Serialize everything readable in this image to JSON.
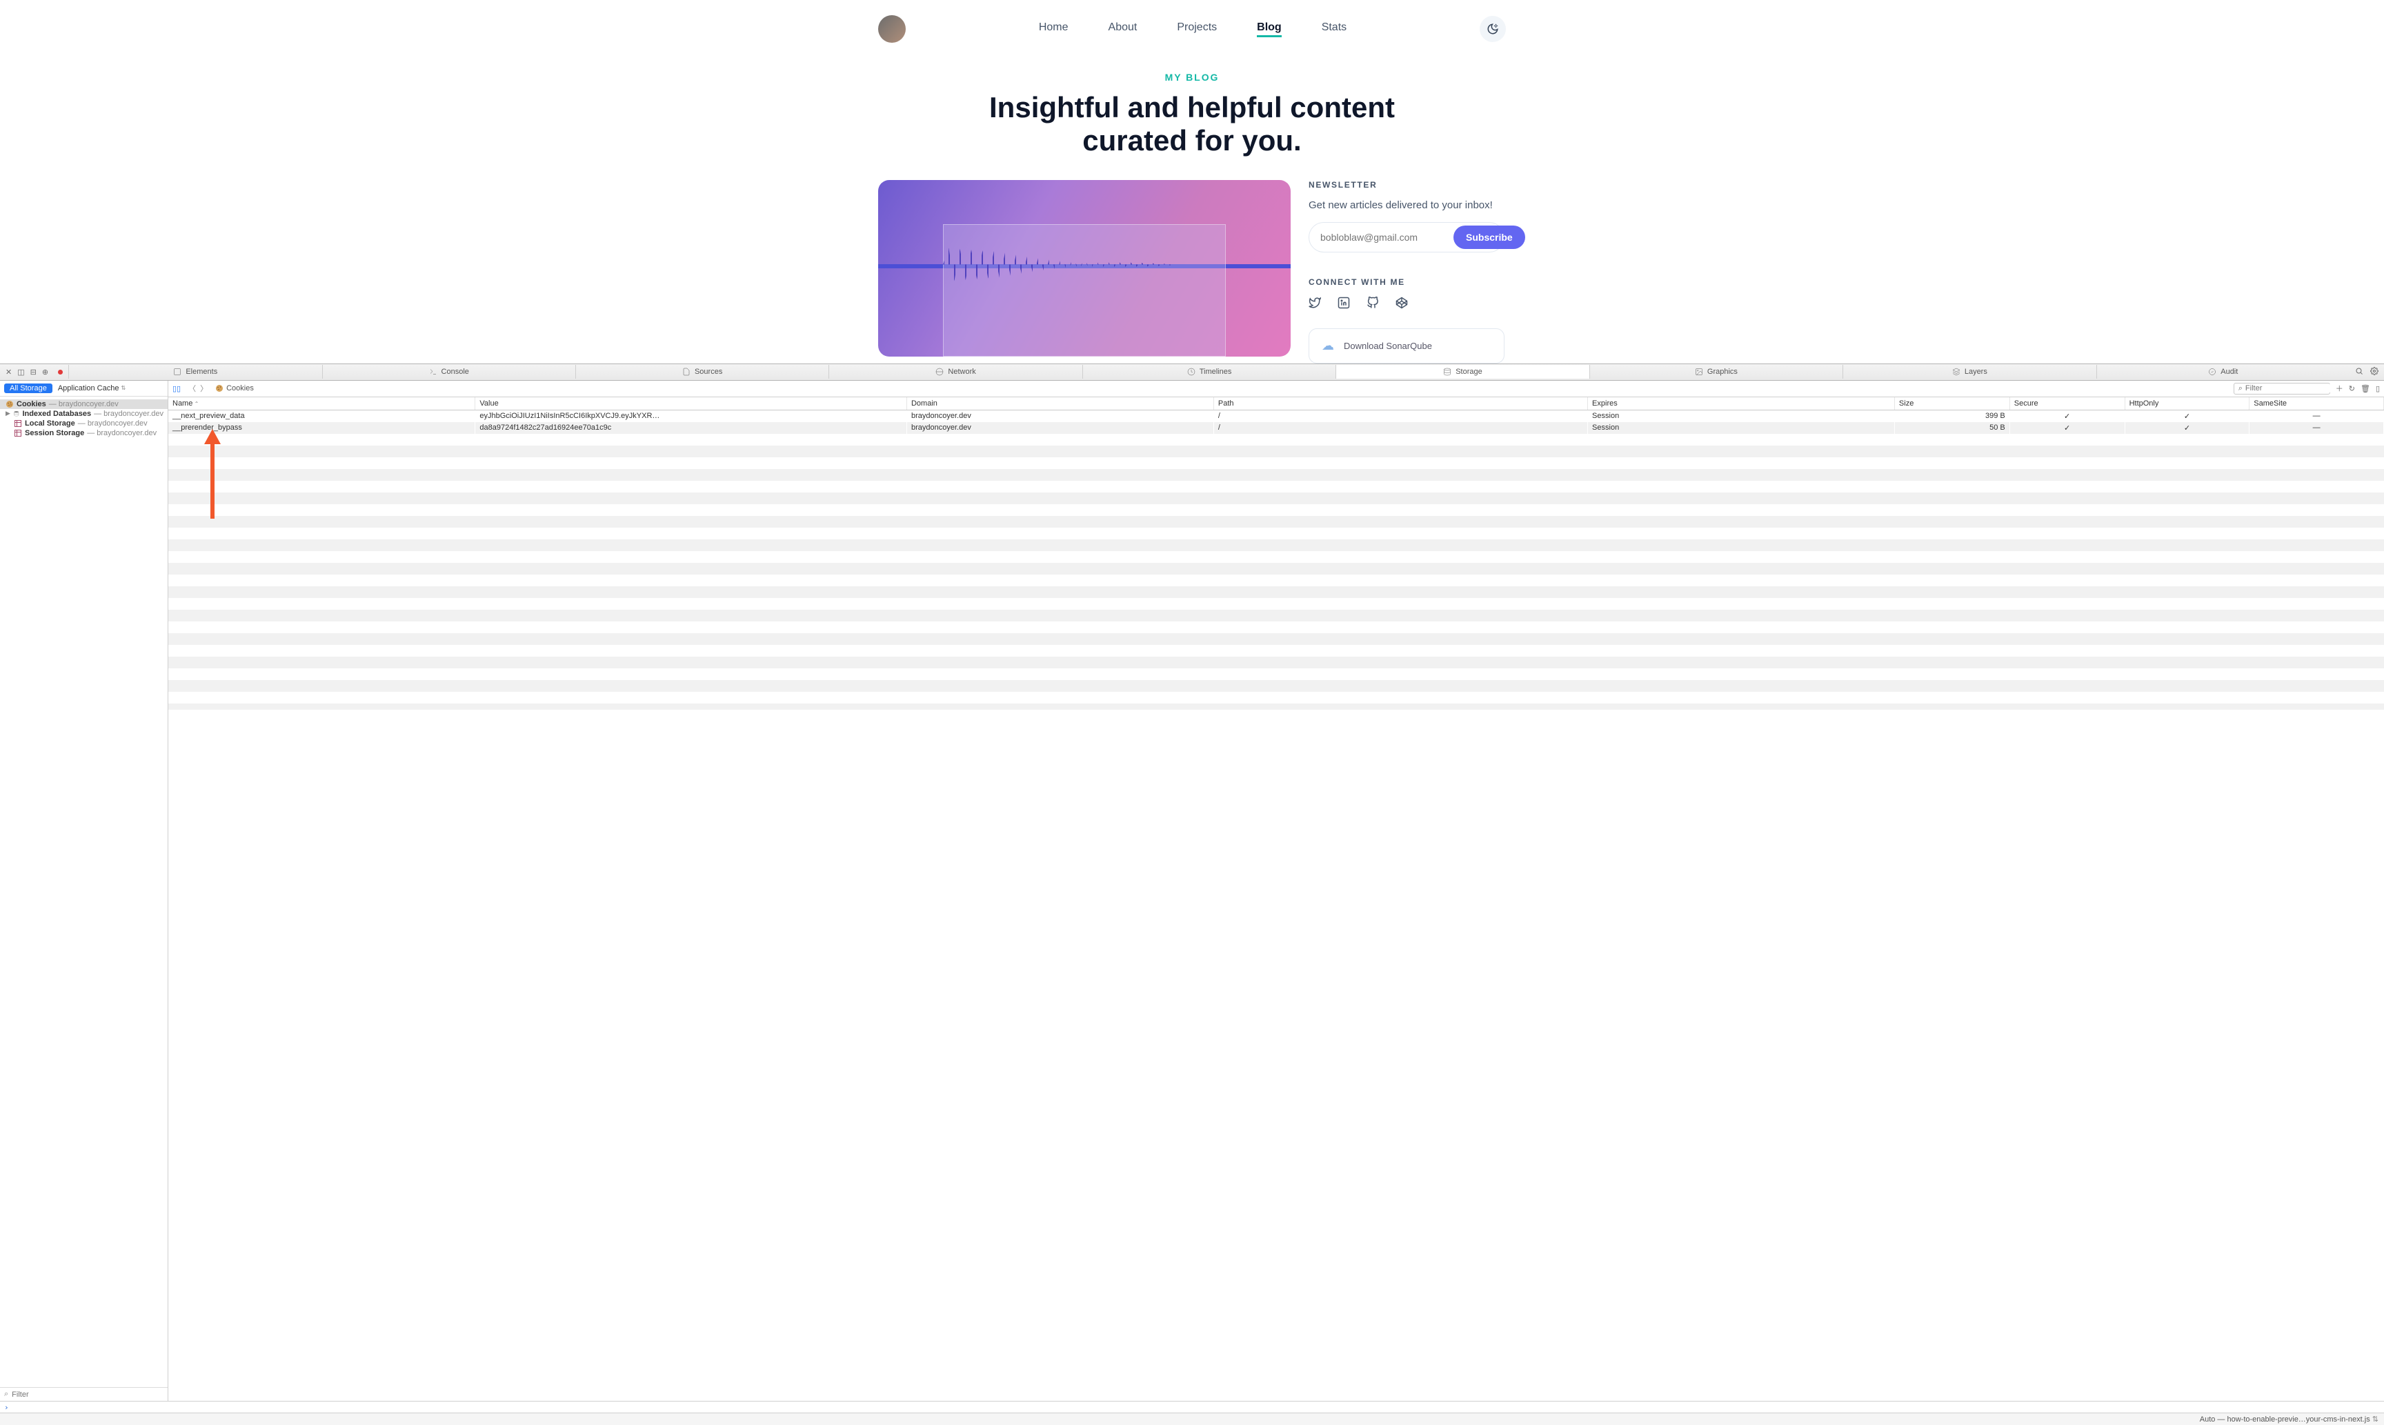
{
  "nav": {
    "links": [
      "Home",
      "About",
      "Projects",
      "Blog",
      "Stats"
    ],
    "active": "Blog"
  },
  "hero": {
    "eyebrow": "MY BLOG",
    "headline_l1": "Insightful and helpful content",
    "headline_l2": "curated for you."
  },
  "newsletter": {
    "title": "NEWSLETTER",
    "blurb": "Get new articles delivered to your inbox!",
    "placeholder": "bobloblaw@gmail.com",
    "button": "Subscribe"
  },
  "connect": {
    "title": "CONNECT WITH ME"
  },
  "ad": {
    "text": "Download SonarQube"
  },
  "devtools": {
    "tabs": [
      "Elements",
      "Console",
      "Sources",
      "Network",
      "Timelines",
      "Storage",
      "Graphics",
      "Layers",
      "Audit"
    ],
    "active_tab": "Storage",
    "subtabs": {
      "active": "All Storage",
      "other": "Application Cache"
    },
    "tree": {
      "cookies": {
        "label": "Cookies",
        "domain": "braydoncoyer.dev"
      },
      "idb": {
        "label": "Indexed Databases",
        "domain": "braydoncoyer.dev"
      },
      "local": {
        "label": "Local Storage",
        "domain": "braydoncoyer.dev"
      },
      "session": {
        "label": "Session Storage",
        "domain": "braydoncoyer.dev"
      }
    },
    "sidebar_filter_placeholder": "Filter",
    "breadcrumb": "Cookies",
    "filter_placeholder": "Filter",
    "columns": [
      "Name",
      "Value",
      "Domain",
      "Path",
      "Expires",
      "Size",
      "Secure",
      "HttpOnly",
      "SameSite"
    ],
    "rows": [
      {
        "name": "__next_preview_data",
        "value": "eyJhbGciOiJIUzI1NiIsInR5cCI6IkpXVCJ9.eyJkYXR…",
        "domain": "braydoncoyer.dev",
        "path": "/",
        "expires": "Session",
        "size": "399 B",
        "secure": "✓",
        "httponly": "✓",
        "samesite": "—"
      },
      {
        "name": "__prerender_bypass",
        "value": "da8a9724f1482c27ad16924ee70a1c9c",
        "domain": "braydoncoyer.dev",
        "path": "/",
        "expires": "Session",
        "size": "50 B",
        "secure": "✓",
        "httponly": "✓",
        "samesite": "—"
      }
    ],
    "status_right": "Auto — how-to-enable-previe…your-cms-in-next.js"
  }
}
